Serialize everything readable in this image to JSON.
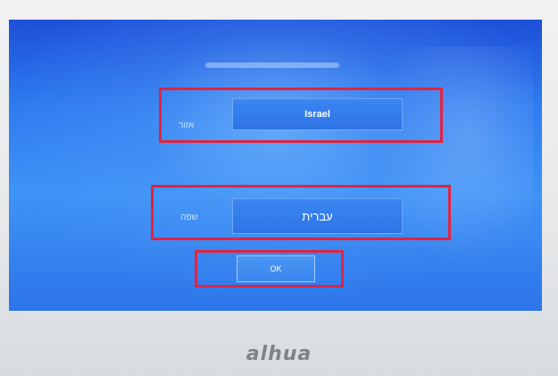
{
  "screen": {
    "region": {
      "label": "אזור",
      "value": "Israel"
    },
    "language": {
      "label": "שפה",
      "value": "עברית"
    },
    "ok_label": "OK"
  },
  "brand": {
    "logo_text": "alhua"
  },
  "colors": {
    "screen_blue": "#2f7cf0",
    "highlight_red": "#e0243f",
    "bezel": "#e6e8ea"
  }
}
